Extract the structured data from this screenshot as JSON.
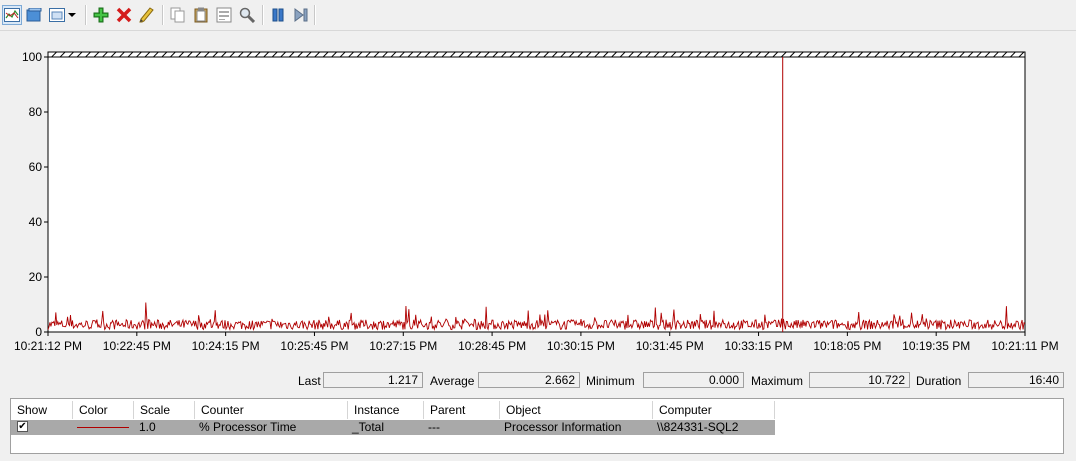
{
  "toolbar": {
    "buttons": [
      {
        "name": "view-graph-icon"
      },
      {
        "name": "view-histogram-icon"
      },
      {
        "name": "change-graph-type-icon"
      },
      {
        "name": "graph-type-dropdown-icon"
      },
      {
        "name": "add-counter-icon"
      },
      {
        "name": "delete-counter-icon"
      },
      {
        "name": "highlight-icon"
      },
      {
        "name": "copy-properties-icon"
      },
      {
        "name": "paste-counter-list-icon"
      },
      {
        "name": "properties-icon"
      },
      {
        "name": "zoom-icon"
      },
      {
        "name": "freeze-display-icon"
      },
      {
        "name": "update-data-icon"
      }
    ]
  },
  "chart_data": {
    "type": "line",
    "ylim": [
      0,
      100
    ],
    "yticks": [
      "100",
      "80",
      "60",
      "40",
      "20",
      "0"
    ],
    "xticks": [
      "10:21:12 PM",
      "10:22:45 PM",
      "10:24:15 PM",
      "10:25:45 PM",
      "10:27:15 PM",
      "10:28:45 PM",
      "10:30:15 PM",
      "10:31:45 PM",
      "10:33:15 PM",
      "10:18:05 PM",
      "10:19:35 PM",
      "10:21:11 PM"
    ],
    "grid": false,
    "cursor_fraction": 0.752,
    "series": [
      {
        "color": "#b00000",
        "samples": 1000,
        "mean": 2.662,
        "min": 0.0,
        "max": 10.722
      }
    ]
  },
  "stats": {
    "last_label": "Last",
    "last_value": "1.217",
    "average_label": "Average",
    "average_value": "2.662",
    "minimum_label": "Minimum",
    "minimum_value": "0.000",
    "maximum_label": "Maximum",
    "maximum_value": "10.722",
    "duration_label": "Duration",
    "duration_value": "16:40"
  },
  "legend": {
    "headers": [
      "Show",
      "Color",
      "Scale",
      "Counter",
      "Instance",
      "Parent",
      "Object",
      "Computer"
    ],
    "rows": [
      {
        "show": "✔",
        "color": "#b00000",
        "scale": "1.0",
        "counter": "% Processor Time",
        "instance": "_Total",
        "parent": "---",
        "object": "Processor Information",
        "computer": "\\\\824331-SQL2"
      }
    ]
  }
}
